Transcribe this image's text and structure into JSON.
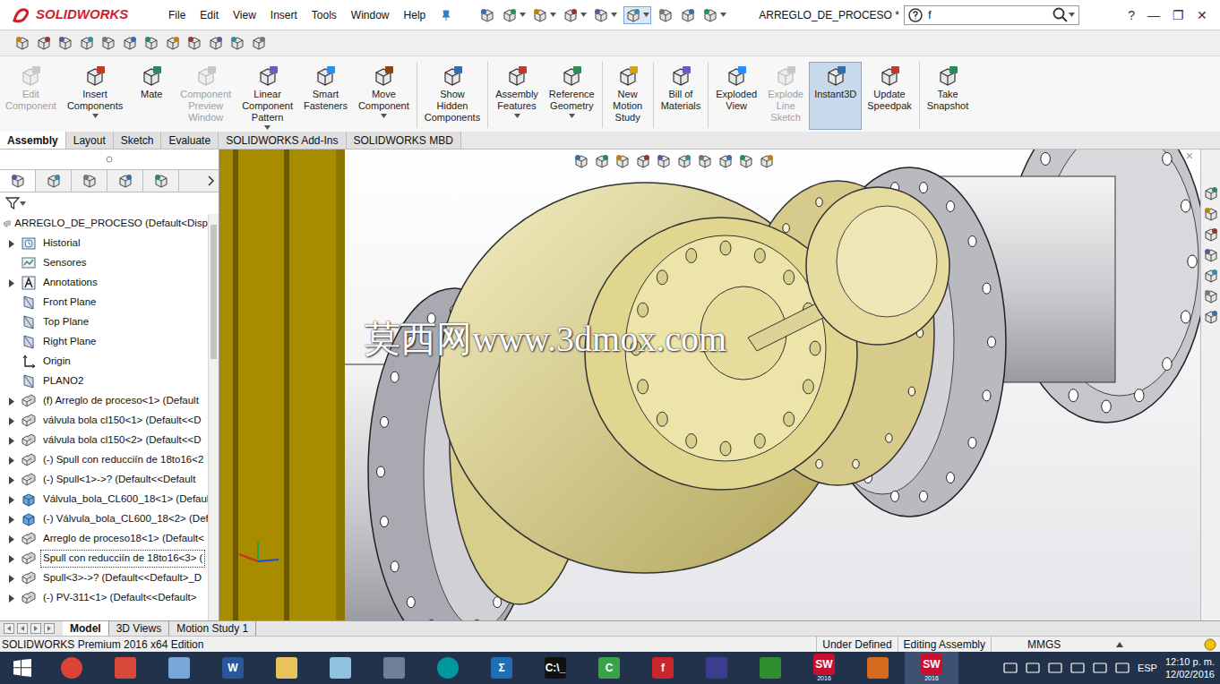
{
  "app": {
    "logo": "SOLIDWORKS",
    "title": "ARREGLO_DE_PROCESO *"
  },
  "menu": [
    "File",
    "Edit",
    "View",
    "Insert",
    "Tools",
    "Window",
    "Help"
  ],
  "search": {
    "value": "f"
  },
  "window_controls": [
    "?",
    "—",
    "❐",
    "✕"
  ],
  "ribbon": [
    {
      "lines": [
        "Edit",
        "Component"
      ],
      "disabled": true,
      "selected": false,
      "dropdown": false,
      "separator_after": false
    },
    {
      "lines": [
        "Insert",
        "Components"
      ],
      "disabled": false,
      "selected": false,
      "dropdown": true,
      "separator_after": false
    },
    {
      "lines": [
        "Mate"
      ],
      "disabled": false,
      "selected": false,
      "dropdown": false,
      "separator_after": false
    },
    {
      "lines": [
        "Component",
        "Preview",
        "Window"
      ],
      "disabled": true,
      "selected": false,
      "dropdown": false,
      "separator_after": false
    },
    {
      "lines": [
        "Linear",
        "Component",
        "Pattern"
      ],
      "disabled": false,
      "selected": false,
      "dropdown": true,
      "separator_after": false
    },
    {
      "lines": [
        "Smart",
        "Fasteners"
      ],
      "disabled": false,
      "selected": false,
      "dropdown": false,
      "separator_after": false
    },
    {
      "lines": [
        "Move",
        "Component"
      ],
      "disabled": false,
      "selected": false,
      "dropdown": true,
      "separator_after": true
    },
    {
      "lines": [
        "Show",
        "Hidden",
        "Components"
      ],
      "disabled": false,
      "selected": false,
      "dropdown": false,
      "separator_after": true
    },
    {
      "lines": [
        "Assembly",
        "Features"
      ],
      "disabled": false,
      "selected": false,
      "dropdown": true,
      "separator_after": false
    },
    {
      "lines": [
        "Reference",
        "Geometry"
      ],
      "disabled": false,
      "selected": false,
      "dropdown": true,
      "separator_after": true
    },
    {
      "lines": [
        "New",
        "Motion",
        "Study"
      ],
      "disabled": false,
      "selected": false,
      "dropdown": false,
      "separator_after": true
    },
    {
      "lines": [
        "Bill of",
        "Materials"
      ],
      "disabled": false,
      "selected": false,
      "dropdown": false,
      "separator_after": true
    },
    {
      "lines": [
        "Exploded",
        "View"
      ],
      "disabled": false,
      "selected": false,
      "dropdown": false,
      "separator_after": false
    },
    {
      "lines": [
        "Explode",
        "Line",
        "Sketch"
      ],
      "disabled": true,
      "selected": false,
      "dropdown": false,
      "separator_after": false
    },
    {
      "lines": [
        "Instant3D"
      ],
      "disabled": false,
      "selected": true,
      "dropdown": false,
      "separator_after": false
    },
    {
      "lines": [
        "Update",
        "Speedpak"
      ],
      "disabled": false,
      "selected": false,
      "dropdown": false,
      "separator_after": true
    },
    {
      "lines": [
        "Take",
        "Snapshot"
      ],
      "disabled": false,
      "selected": false,
      "dropdown": false,
      "separator_after": false
    }
  ],
  "tabs": [
    {
      "label": "Assembly",
      "selected": true
    },
    {
      "label": "Layout",
      "selected": false
    },
    {
      "label": "Sketch",
      "selected": false
    },
    {
      "label": "Evaluate",
      "selected": false
    },
    {
      "label": "SOLIDWORKS Add-Ins",
      "selected": false
    },
    {
      "label": "SOLIDWORKS MBD",
      "selected": false
    }
  ],
  "tree": {
    "root": "ARREGLO_DE_PROCESO  (Default<Disp",
    "items": [
      {
        "label": "Historial",
        "kind": "history",
        "expandable": true,
        "selected": false
      },
      {
        "label": "Sensores",
        "kind": "sensor",
        "expandable": false,
        "selected": false
      },
      {
        "label": "Annotations",
        "kind": "annotation",
        "expandable": true,
        "selected": false
      },
      {
        "label": "Front Plane",
        "kind": "plane",
        "expandable": false,
        "selected": false
      },
      {
        "label": "Top Plane",
        "kind": "plane",
        "expandable": false,
        "selected": false
      },
      {
        "label": "Right Plane",
        "kind": "plane",
        "expandable": false,
        "selected": false
      },
      {
        "label": "Origin",
        "kind": "origin",
        "expandable": false,
        "selected": false
      },
      {
        "label": "PLANO2",
        "kind": "plane",
        "expandable": false,
        "selected": false
      },
      {
        "label": "(f) Arreglo de proceso<1> (Default",
        "kind": "assembly",
        "expandable": true,
        "selected": false
      },
      {
        "label": "válvula bola cl150<1> (Default<<D",
        "kind": "assembly",
        "expandable": true,
        "selected": false
      },
      {
        "label": "válvula bola cl150<2> (Default<<D",
        "kind": "assembly",
        "expandable": true,
        "selected": false
      },
      {
        "label": "(-) Spull con reducciín de 18to16<2",
        "kind": "assembly",
        "expandable": true,
        "selected": false
      },
      {
        "label": "(-) Spull<1>->? (Default<<Default",
        "kind": "assembly",
        "expandable": true,
        "selected": false
      },
      {
        "label": "Válvula_bola_CL600_18<1> (Defaul",
        "kind": "part",
        "expandable": true,
        "selected": false
      },
      {
        "label": "(-) Válvula_bola_CL600_18<2> (Def",
        "kind": "part",
        "expandable": true,
        "selected": false
      },
      {
        "label": "Arreglo de proceso18<1> (Default<",
        "kind": "assembly",
        "expandable": true,
        "selected": false
      },
      {
        "label": "Spull con reducciín de 18to16<3> (",
        "kind": "assembly",
        "expandable": true,
        "selected": true
      },
      {
        "label": "Spull<3>->? (Default<<Default>_D",
        "kind": "assembly",
        "expandable": true,
        "selected": false
      },
      {
        "label": "(-) PV-311<1> (Default<<Default>",
        "kind": "assembly",
        "expandable": true,
        "selected": false
      }
    ]
  },
  "graphics": {
    "watermark": "莫西网www.3dmox.com",
    "close": "×"
  },
  "bottom_tabs": [
    {
      "label": "Model",
      "selected": true
    },
    {
      "label": "3D Views",
      "selected": false
    },
    {
      "label": "Motion Study 1",
      "selected": false
    }
  ],
  "status_bar": {
    "edition": "SOLIDWORKS Premium 2016 x64 Edition",
    "items": [
      "Under Defined",
      "Editing Assembly",
      "MMGS"
    ]
  },
  "taskbar": {
    "apps": [
      {
        "shape": "circle",
        "glyph": "",
        "color": "#db4437",
        "badge": "",
        "active": false
      },
      {
        "shape": "square",
        "glyph": "",
        "color": "#d8493a",
        "badge": "",
        "active": false
      },
      {
        "shape": "square",
        "glyph": "",
        "color": "#7aa7d9",
        "badge": "",
        "active": false
      },
      {
        "shape": "square",
        "glyph": "W",
        "color": "#2b579a",
        "badge": "",
        "active": false
      },
      {
        "shape": "square",
        "glyph": "",
        "color": "#e8c25a",
        "badge": "",
        "active": false
      },
      {
        "shape": "square",
        "glyph": "",
        "color": "#8fc3e0",
        "badge": "",
        "active": false
      },
      {
        "shape": "square",
        "glyph": "",
        "color": "#6f7f9a",
        "badge": "",
        "active": false
      },
      {
        "shape": "circle",
        "glyph": "",
        "color": "#00979d",
        "badge": "",
        "active": false
      },
      {
        "shape": "square",
        "glyph": "Σ",
        "color": "#1f6fb5",
        "badge": "",
        "active": false
      },
      {
        "shape": "square",
        "glyph": "C:\\_",
        "color": "#111111",
        "badge": "",
        "active": false
      },
      {
        "shape": "square",
        "glyph": "C",
        "color": "#3aa34a",
        "badge": "",
        "active": false
      },
      {
        "shape": "square",
        "glyph": "f",
        "color": "#c8262b",
        "badge": "",
        "active": false
      },
      {
        "shape": "square",
        "glyph": "",
        "color": "#3d3d8f",
        "badge": "",
        "active": false
      },
      {
        "shape": "square",
        "glyph": "",
        "color": "#2f8f2f",
        "badge": "",
        "active": false
      },
      {
        "shape": "square",
        "glyph": "SW",
        "color": "#c8102e",
        "badge": "2016",
        "active": false
      },
      {
        "shape": "square",
        "glyph": "",
        "color": "#d86a1e",
        "badge": "",
        "active": false
      },
      {
        "shape": "square",
        "glyph": "SW",
        "color": "#c8102e",
        "badge": "2016",
        "active": true
      }
    ],
    "language": "ESP",
    "time": "12:10 p. m.",
    "date": "12/02/2016"
  }
}
